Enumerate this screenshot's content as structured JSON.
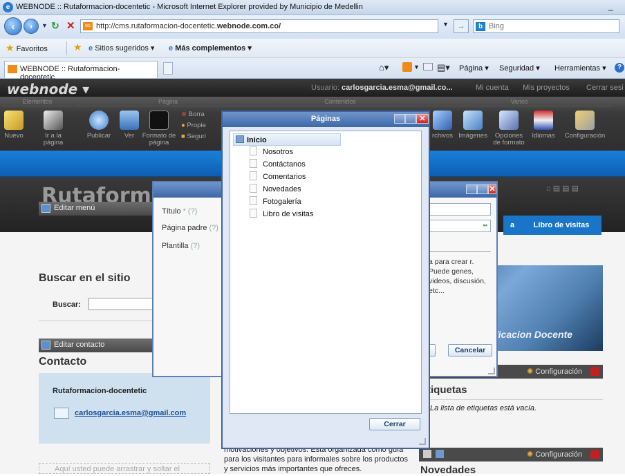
{
  "browser": {
    "window_title": "WEBNODE :: Rutaformacion-docentetic - Microsoft Internet Explorer provided by Municipio de Medellin",
    "address_prefix": "http://cms.rutaformacion-docentetic.",
    "address_domain": "webnode.com.co/",
    "search_placeholder": "Bing",
    "favorites_label": "Favoritos",
    "suggested_sites": "Sitios sugeridos ▾",
    "more_addons": "Más complementos ▾",
    "tab_title": "WEBNODE :: Rutaformacion-docentetic",
    "cmd_pagina": "Página ▾",
    "cmd_seguridad": "Seguridad ▾",
    "cmd_herramientas": "Herramientas ▾"
  },
  "webnode": {
    "logo": "webnode ▾",
    "user_prefix": "Usuario: ",
    "user_email": "carlosgarcia.esma@gmail.co...",
    "account_link": "Mi cuenta",
    "projects_link": "Mis proyectos",
    "logout_link": "Cerrar sesi",
    "groups": {
      "elementos": "Elementos",
      "pagina": "Página",
      "contenidos": "Contenidos",
      "varios": "Varios"
    },
    "tools": {
      "nuevo": "Nuevo",
      "ir_pagina": "Ir a la página",
      "publicar": "Publicar",
      "ver": "Ver",
      "formato": "Formato de página",
      "borrar": "Borra",
      "propiedades": "Propie",
      "seguridad": "Seguri",
      "archivos": "rchivos",
      "imagenes": "Imágenes",
      "opciones": "Opciones de formato",
      "idiomas": "Idiomas",
      "configuracion": "Configuración"
    }
  },
  "site": {
    "title": "Rutaforma",
    "edit_menu": "Editar menú",
    "nav_libro": "Libro de visitas",
    "nav_partial": "a",
    "search_heading": "Buscar en el sitio",
    "search_label": "Buscar:",
    "edit_contact": "Editar contacto",
    "contact_heading": "Contacto",
    "contact_name": "Rutaformacion-docentetic",
    "contact_email": "carlosgarcia.esma@gmail.com",
    "drop_note": "Aquí usted puede arrastrar y soltar el",
    "promo_text": "ficacion Docente",
    "config_label": "Configuración",
    "tags_heading": "tiquetas",
    "tags_empty": "La lista de etiquetas está vacía.",
    "news_heading": "Novedades",
    "mid_text": "motivaciones y objetivos. Esta organizada como guía para los visitantes para informales sobre los productos y servicios más importantes que ofreces."
  },
  "back_dialog": {
    "title_label": "Título",
    "parent_label": "Página padre",
    "template_label": "Plantilla",
    "help": "(?)",
    "required": "*",
    "text": "a para crear r. Puede genes, videos, discusión, etc...",
    "btn_partial": "r",
    "btn_cancel": "Cancelar"
  },
  "pages_dialog": {
    "title": "Páginas",
    "root": "Inicio",
    "pages": [
      "Nosotros",
      "Contáctanos",
      "Comentarios",
      "Novedades",
      "Fotogalería",
      "Libro de visitas"
    ],
    "close_button": "Cerrar"
  }
}
